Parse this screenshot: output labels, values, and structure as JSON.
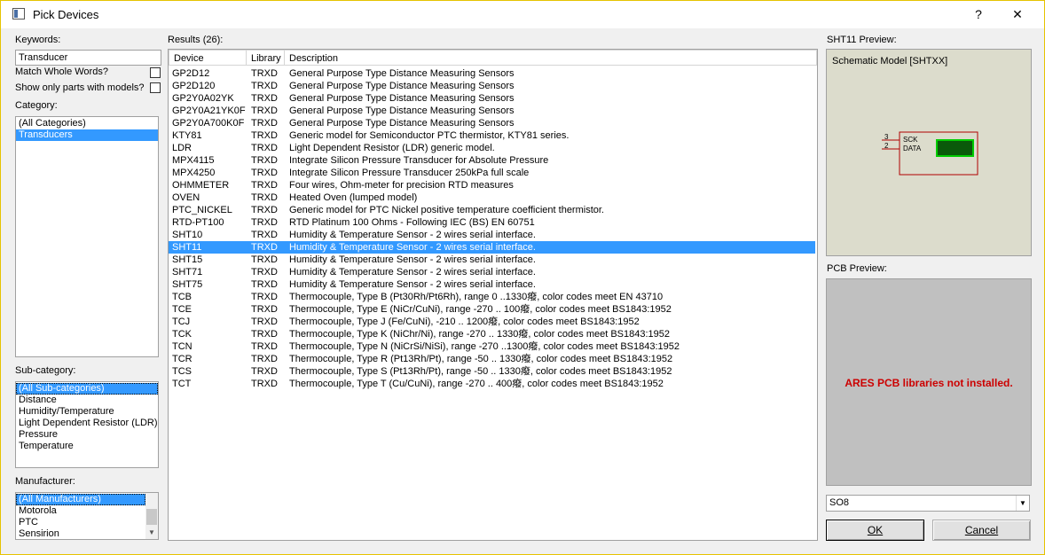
{
  "window": {
    "title": "Pick Devices",
    "help_label": "?",
    "close_label": "✕"
  },
  "left": {
    "keywords_label": "Keywords:",
    "keywords_value": "Transducer",
    "match_whole_words_label": "Match Whole Words?",
    "show_only_models_label": "Show only parts with models?",
    "category_label": "Category:",
    "categories": [
      "(All Categories)",
      "Transducers"
    ],
    "subcategory_label": "Sub-category:",
    "subcategories": [
      "(All Sub-categories)",
      "Distance",
      "Humidity/Temperature",
      "Light Dependent Resistor (LDR)",
      "Pressure",
      "Temperature"
    ],
    "manufacturer_label": "Manufacturer:",
    "manufacturers": [
      "(All Manufacturers)",
      "Motorola",
      "PTC",
      "Sensirion"
    ]
  },
  "results": {
    "label": "Results (26):",
    "columns": [
      "Device",
      "Library",
      "Description"
    ],
    "selected_device": "SHT11",
    "rows": [
      {
        "device": "GP2D12",
        "library": "TRXD",
        "description": "General Purpose Type Distance Measuring Sensors"
      },
      {
        "device": "GP2D120",
        "library": "TRXD",
        "description": "General Purpose Type Distance Measuring Sensors"
      },
      {
        "device": "GP2Y0A02YK",
        "library": "TRXD",
        "description": "General Purpose Type Distance Measuring Sensors"
      },
      {
        "device": "GP2Y0A21YK0F",
        "library": "TRXD",
        "description": "General Purpose Type Distance Measuring Sensors"
      },
      {
        "device": "GP2Y0A700K0F",
        "library": "TRXD",
        "description": "General Purpose Type Distance Measuring Sensors"
      },
      {
        "device": "KTY81",
        "library": "TRXD",
        "description": "Generic model for Semiconductor PTC thermistor, KTY81 series."
      },
      {
        "device": "LDR",
        "library": "TRXD",
        "description": "Light Dependent Resistor (LDR) generic model."
      },
      {
        "device": "MPX4115",
        "library": "TRXD",
        "description": "Integrate Silicon Pressure Transducer for Absolute Pressure"
      },
      {
        "device": "MPX4250",
        "library": "TRXD",
        "description": "Integrate Silicon Pressure Transducer 250kPa full scale"
      },
      {
        "device": "OHMMETER",
        "library": "TRXD",
        "description": "Four wires, Ohm-meter for precision RTD measures"
      },
      {
        "device": "OVEN",
        "library": "TRXD",
        "description": "Heated Oven (lumped model)"
      },
      {
        "device": "PTC_NICKEL",
        "library": "TRXD",
        "description": "Generic model for PTC Nickel positive temperature coefficient thermistor."
      },
      {
        "device": "RTD-PT100",
        "library": "TRXD",
        "description": "RTD Platinum 100 Ohms - Following IEC (BS) EN 60751"
      },
      {
        "device": "SHT10",
        "library": "TRXD",
        "description": "Humidity & Temperature Sensor - 2 wires serial interface."
      },
      {
        "device": "SHT11",
        "library": "TRXD",
        "description": "Humidity & Temperature Sensor - 2 wires serial interface."
      },
      {
        "device": "SHT15",
        "library": "TRXD",
        "description": "Humidity & Temperature Sensor - 2 wires serial interface."
      },
      {
        "device": "SHT71",
        "library": "TRXD",
        "description": "Humidity & Temperature Sensor - 2 wires serial interface."
      },
      {
        "device": "SHT75",
        "library": "TRXD",
        "description": "Humidity & Temperature Sensor - 2 wires serial interface."
      },
      {
        "device": "TCB",
        "library": "TRXD",
        "description": "Thermocouple, Type B (Pt30Rh/Pt6Rh), range 0 ..1330癈, color codes meet EN 43710"
      },
      {
        "device": "TCE",
        "library": "TRXD",
        "description": "Thermocouple, Type E (NiCr/CuNi), range -270 .. 100癈, color codes meet BS1843:1952"
      },
      {
        "device": "TCJ",
        "library": "TRXD",
        "description": "Thermocouple, Type J (Fe/CuNi), -210 .. 1200癈, color codes meet BS1843:1952"
      },
      {
        "device": "TCK",
        "library": "TRXD",
        "description": "Thermocouple, Type K (NiChr/Ni), range -270 .. 1330癈, color codes meet BS1843:1952"
      },
      {
        "device": "TCN",
        "library": "TRXD",
        "description": "Thermocouple, Type N (NiCrSi/NiSi), range -270 ..1300癈, color codes meet BS1843:1952"
      },
      {
        "device": "TCR",
        "library": "TRXD",
        "description": "Thermocouple, Type R (Pt13Rh/Pt), range -50 .. 1330癈, color codes meet BS1843:1952"
      },
      {
        "device": "TCS",
        "library": "TRXD",
        "description": "Thermocouple, Type S (Pt13Rh/Pt), range -50 .. 1330癈, color codes meet BS1843:1952"
      },
      {
        "device": "TCT",
        "library": "TRXD",
        "description": "Thermocouple, Type T (Cu/CuNi), range -270 .. 400癈, color codes meet BS1843:1952"
      }
    ]
  },
  "preview": {
    "schematic_label": "SHT11 Preview:",
    "schematic_model": "Schematic Model [SHTXX]",
    "pin_sck_num": "3",
    "pin_data_num": "2",
    "pin_sck_name": "SCK",
    "pin_data_name": "DATA",
    "pcb_label": "PCB Preview:",
    "pcb_message": "ARES PCB libraries not installed.",
    "package_value": "SO8",
    "ok_label": "OK",
    "cancel_label": "Cancel"
  },
  "colors": {
    "selection": "#3399ff",
    "preview_bg": "#dcdccc",
    "error_text": "#cc0000",
    "component_outline": "#b00000",
    "lcd_fill": "#0a5a0a"
  }
}
